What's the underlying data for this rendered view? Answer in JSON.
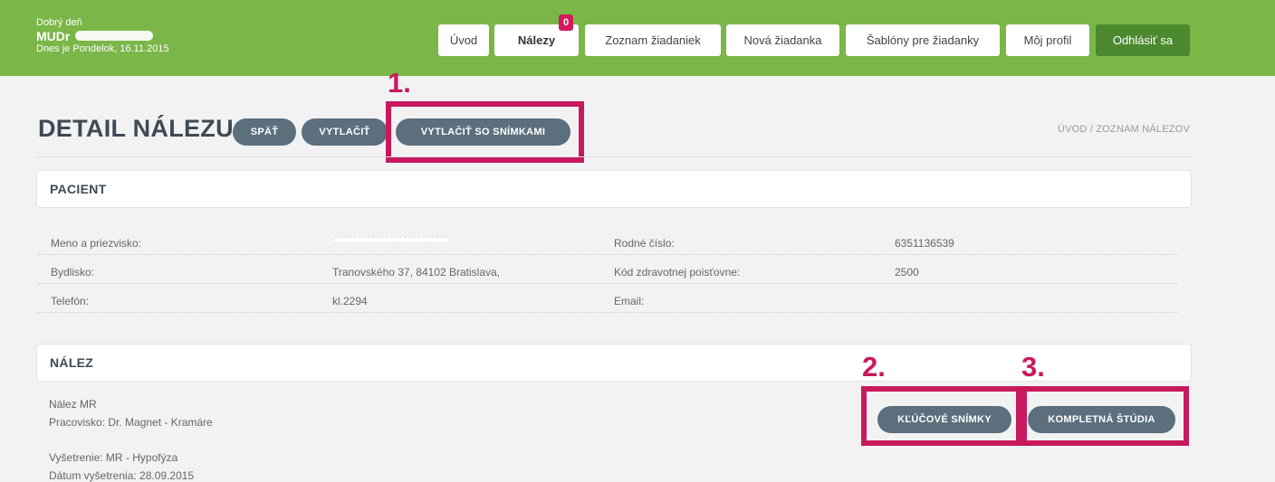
{
  "header": {
    "greeting": "Dobrý deň",
    "doctor_prefix": "MUDr",
    "date_line": "Dnes je Pondelok, 16.11.2015",
    "nav": [
      {
        "label": "Úvod"
      },
      {
        "label": "Nálezy",
        "badge": "0"
      },
      {
        "label": "Zoznam žiadaniek"
      },
      {
        "label": "Nová žiadanka"
      },
      {
        "label": "Šablóny pre žiadanky"
      },
      {
        "label": "Môj profil"
      },
      {
        "label": "Odhlásiť sa"
      }
    ]
  },
  "page": {
    "title": "DETAIL NÁLEZU",
    "buttons": {
      "back": "SPÄŤ",
      "print": "VYTLAČIŤ",
      "print_images": "VYTLAČIŤ SO SNÍMKAMI"
    },
    "breadcrumb": "ÚVOD / ZOZNAM NÁLEZOV"
  },
  "annotations": {
    "one": "1.",
    "two": "2.",
    "three": "3."
  },
  "patient": {
    "heading": "PACIENT",
    "rows": [
      {
        "l1": "Meno a priezvisko:",
        "v1": "",
        "l2": "Rodné číslo:",
        "v2": "6351136539"
      },
      {
        "l1": "Bydlisko:",
        "v1": "Tranovského 37, 84102 Bratislava,",
        "l2": "Kód zdravotnej poisťovne:",
        "v2": "2500"
      },
      {
        "l1": "Telefón:",
        "v1": "kl.2294",
        "l2": "Email:",
        "v2": ""
      }
    ]
  },
  "finding": {
    "heading": "NÁLEZ",
    "type": "Nález MR",
    "workplace": "Pracovisko: Dr. Magnet - Kramáre",
    "exam": "Vyšetrenie: MR - Hypofýza",
    "exam_date": "Dátum vyšetrenia: 28.09.2015",
    "key_images": "KĽÚČOVÉ SNÍMKY",
    "full_study": "KOMPLETNÁ ŠTÚDIA"
  },
  "colors": {
    "header_green": "#7ab648",
    "logout_green": "#4d8a2f",
    "highlight": "#c8195f",
    "pill": "#5b6f7d"
  }
}
